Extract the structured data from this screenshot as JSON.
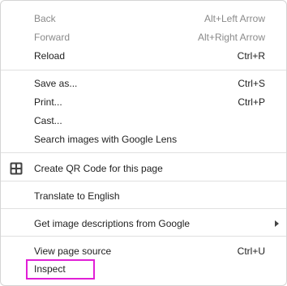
{
  "menu": {
    "items": [
      {
        "label": "Back",
        "shortcut": "Alt+Left Arrow"
      },
      {
        "label": "Forward",
        "shortcut": "Alt+Right Arrow"
      },
      {
        "label": "Reload",
        "shortcut": "Ctrl+R"
      },
      {
        "label": "Save as...",
        "shortcut": "Ctrl+S"
      },
      {
        "label": "Print...",
        "shortcut": "Ctrl+P"
      },
      {
        "label": "Cast...",
        "shortcut": ""
      },
      {
        "label": "Search images with Google Lens",
        "shortcut": ""
      },
      {
        "label": "Create QR Code for this page",
        "shortcut": "",
        "icon": "qr-code-icon"
      },
      {
        "label": "Translate to English",
        "shortcut": ""
      },
      {
        "label": "Get image descriptions from Google",
        "shortcut": "",
        "icon": "chevron-right-icon"
      },
      {
        "label": "View page source",
        "shortcut": "Ctrl+U"
      },
      {
        "label": "Inspect",
        "shortcut": ""
      }
    ],
    "disabled_items": [
      "Back",
      "Forward"
    ],
    "highlight_color": "#e11fd6"
  }
}
